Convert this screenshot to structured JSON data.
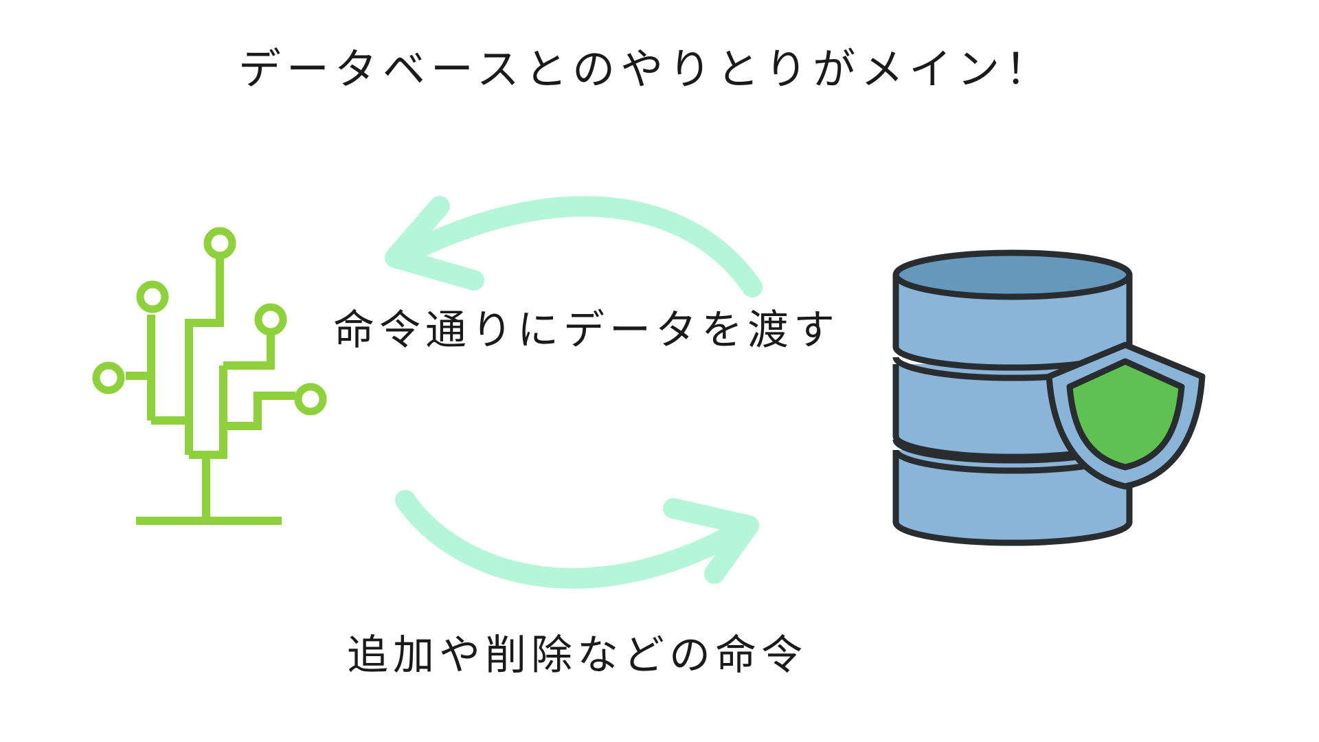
{
  "title": "データベースとのやりとりがメイン！",
  "labels": {
    "top": "命令通りにデータを渡す",
    "bottom": "追加や削除などの命令"
  },
  "icons": {
    "left": "circuit-tree-icon",
    "right": "database-shield-icon",
    "top_arrow": "curved-arrow-left-icon",
    "bottom_arrow": "curved-arrow-right-icon"
  },
  "colors": {
    "circuit": "#8ed13d",
    "arrow": "#b6f6d8",
    "db_fill": "#8ab5d9",
    "db_top": "#6698be",
    "db_outline": "#2a2d2f",
    "shield_outer": "#8ab5d9",
    "shield_inner": "#5ec253",
    "text": "#1a1a1a"
  }
}
